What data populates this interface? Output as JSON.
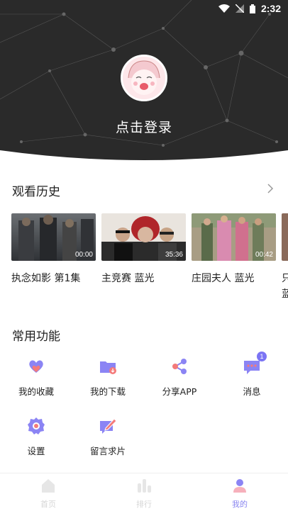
{
  "status_bar": {
    "time": "2:32"
  },
  "header": {
    "login_label": "点击登录"
  },
  "history": {
    "title": "观看历史",
    "items": [
      {
        "title": "执念如影 第1集",
        "duration": "00:00"
      },
      {
        "title": "主竞赛 蓝光",
        "duration": "35:36"
      },
      {
        "title": "庄园夫人 蓝光",
        "duration": "00:42"
      },
      {
        "title": "只",
        "duration": ""
      }
    ],
    "partial_second_line": "蓝"
  },
  "functions": {
    "title": "常用功能",
    "items": [
      {
        "label": "我的收藏",
        "icon": "heart-folder-icon"
      },
      {
        "label": "我的下载",
        "icon": "download-folder-icon"
      },
      {
        "label": "分享APP",
        "icon": "share-icon"
      },
      {
        "label": "消息",
        "icon": "message-icon",
        "badge": "1"
      },
      {
        "label": "设置",
        "icon": "settings-icon"
      },
      {
        "label": "留言求片",
        "icon": "feedback-icon"
      }
    ]
  },
  "bottom_nav": {
    "items": [
      {
        "label": "首页",
        "active": false
      },
      {
        "label": "排行",
        "active": false
      },
      {
        "label": "我的",
        "active": true
      }
    ]
  },
  "colors": {
    "accent": "#7b74f4",
    "header_bg": "#2a2a2a"
  }
}
